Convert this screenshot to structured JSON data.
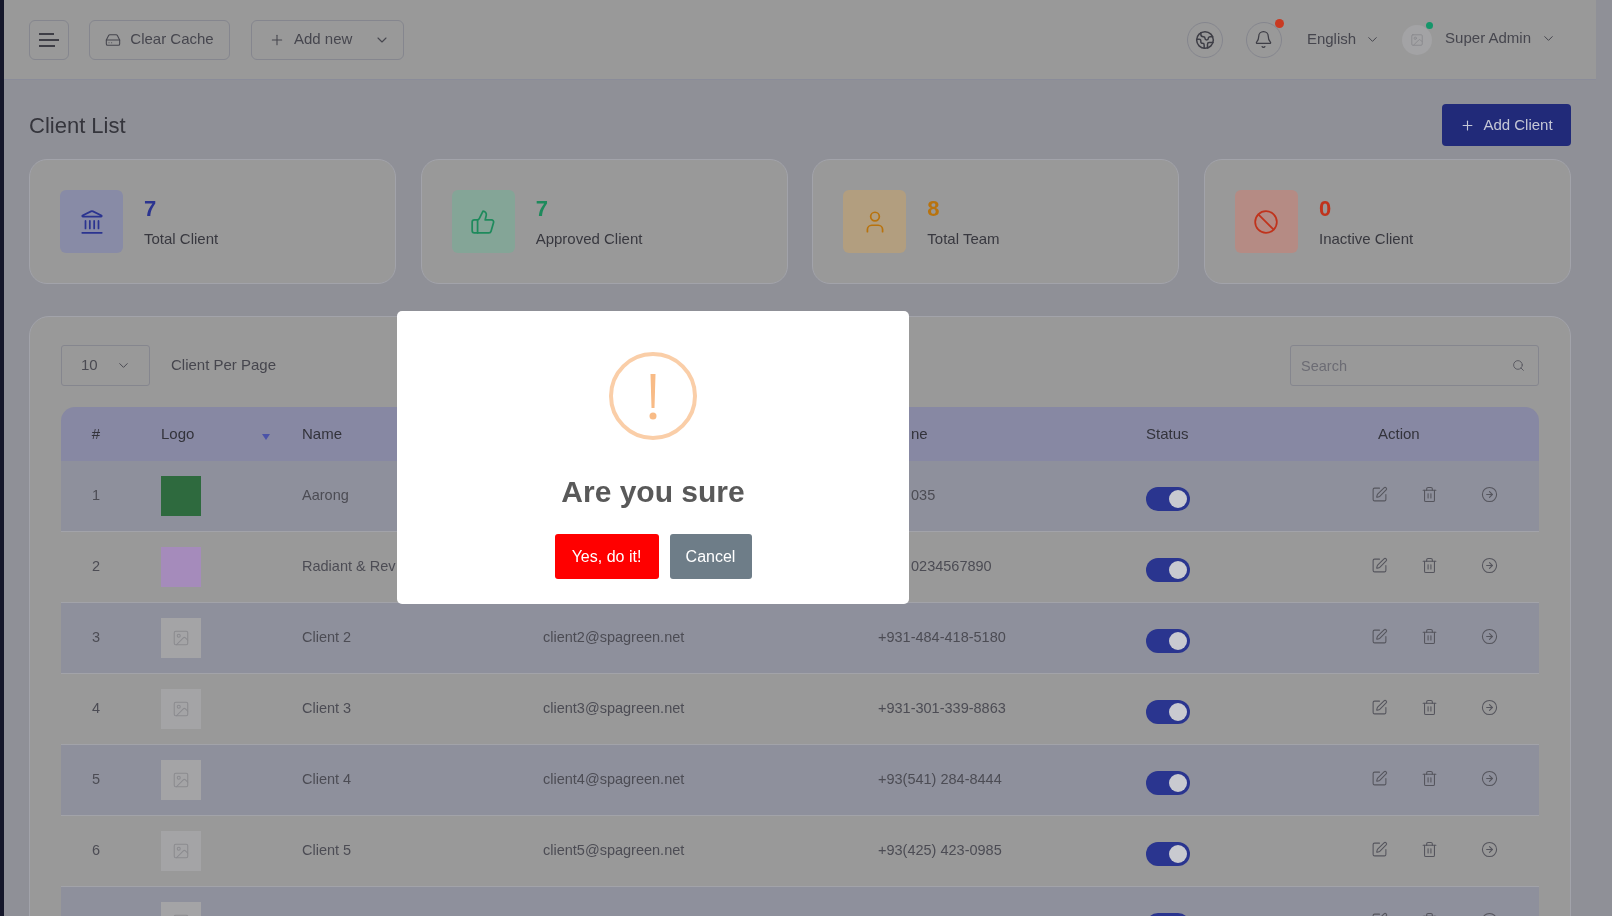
{
  "topbar": {
    "clear_cache": "Clear Cache",
    "add_new": "Add new",
    "notification_dot": true,
    "language": "English",
    "user": {
      "name": "Super Admin",
      "online": true
    }
  },
  "page": {
    "title": "Client List",
    "add_button": "Add Client"
  },
  "stats": [
    {
      "kind": "bank",
      "value": "7",
      "label": "Total Client",
      "color": "#2b3490"
    },
    {
      "kind": "thumbs_up",
      "value": "7",
      "label": "Approved Client",
      "color": "#1e8a5c"
    },
    {
      "kind": "user",
      "value": "8",
      "label": "Total Team",
      "color": "#b8730e"
    },
    {
      "kind": "ban",
      "value": "0",
      "label": "Inactive Client",
      "color": "#c0331c"
    }
  ],
  "table": {
    "per_page": "10",
    "per_page_label": "Client Per Page",
    "search": {
      "placeholder": "Search"
    },
    "header": {
      "number": "#",
      "logo": "Logo",
      "logo_sorted": true,
      "name": "Name",
      "column_5_fragment": "ne",
      "status": "Status",
      "action": "Action"
    },
    "rows": [
      {
        "number": "1",
        "logo": {
          "kind": "photo",
          "color": "#2e6a3e"
        },
        "name": "Aarong",
        "phone_fragment": "035",
        "status_on": true
      },
      {
        "number": "2",
        "logo": {
          "kind": "photo",
          "color": "#a58bbb"
        },
        "name": "Radiant & Rev",
        "phone_fragment": "0234567890",
        "status_on": true
      },
      {
        "number": "3",
        "logo": {
          "kind": "placeholder"
        },
        "name": "Client 2",
        "email": "client2@spagreen.net",
        "phone": "+931-484-418-5180",
        "status_on": true
      },
      {
        "number": "4",
        "logo": {
          "kind": "placeholder"
        },
        "name": "Client 3",
        "email": "client3@spagreen.net",
        "phone": "+931-301-339-8863",
        "status_on": true
      },
      {
        "number": "5",
        "logo": {
          "kind": "placeholder"
        },
        "name": "Client 4",
        "email": "client4@spagreen.net",
        "phone": "+93(541) 284-8444",
        "status_on": true
      },
      {
        "number": "6",
        "logo": {
          "kind": "placeholder"
        },
        "name": "Client 5",
        "email": "client5@spagreen.net",
        "phone": "+93(425) 423-0985",
        "status_on": true
      },
      {
        "logo": {
          "kind": "placeholder"
        },
        "status_on": true
      }
    ]
  },
  "dialog": {
    "title": "Are you sure",
    "buttons": [
      {
        "kind": "confirm",
        "label": "Yes, do it!"
      },
      {
        "kind": "cancel",
        "label": "Cancel"
      }
    ]
  }
}
